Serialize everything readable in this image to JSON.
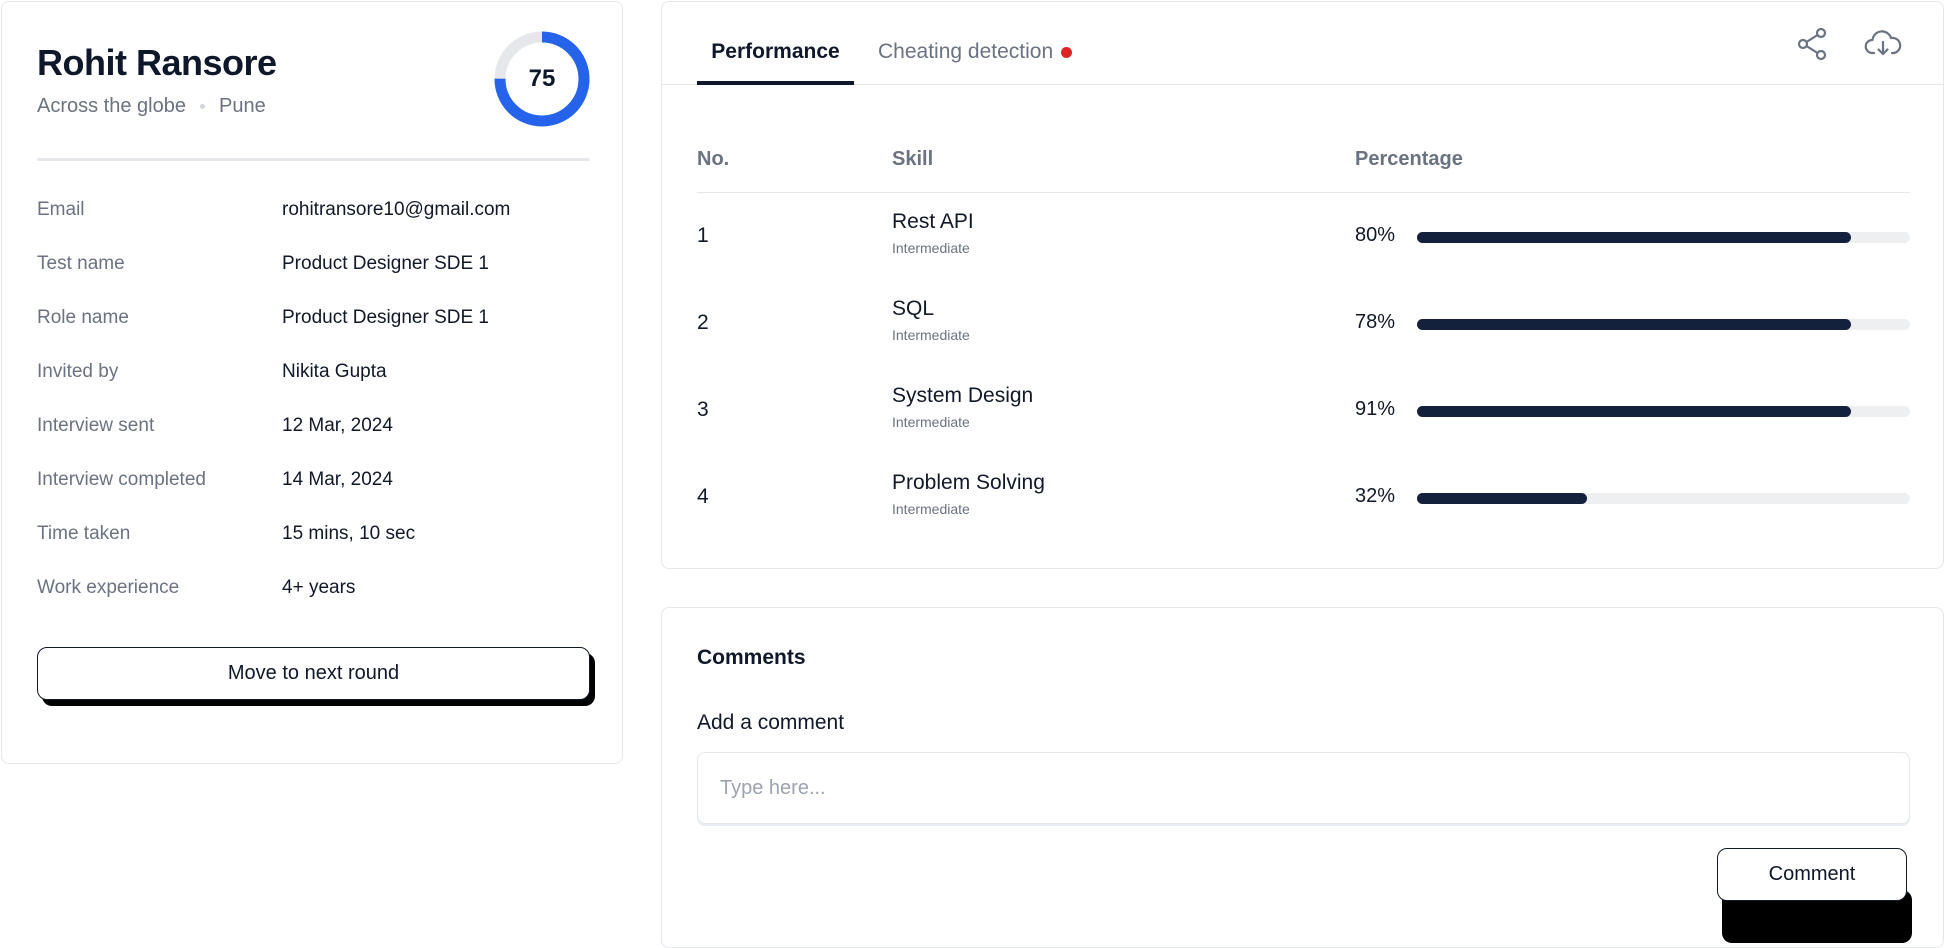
{
  "profile": {
    "name": "Rohit Ransore",
    "location_type": "Across the globe",
    "city": "Pune",
    "score": "75",
    "score_fraction": 0.75,
    "details": [
      {
        "label": "Email",
        "value": "rohitransore10@gmail.com"
      },
      {
        "label": "Test name",
        "value": "Product Designer SDE 1"
      },
      {
        "label": "Role name",
        "value": "Product Designer SDE 1"
      },
      {
        "label": "Invited by",
        "value": "Nikita Gupta"
      },
      {
        "label": "Interview sent",
        "value": "12 Mar, 2024"
      },
      {
        "label": "Interview completed",
        "value": "14 Mar, 2024"
      },
      {
        "label": "Time taken",
        "value": "15 mins, 10 sec"
      },
      {
        "label": "Work experience",
        "value": "4+ years"
      }
    ],
    "next_round_label": "Move to next round"
  },
  "tabs": {
    "performance": "Performance",
    "cheating": "Cheating detection"
  },
  "icons": {
    "share": "share-icon",
    "download": "cloud-download-icon"
  },
  "table": {
    "headers": {
      "no": "No.",
      "skill": "Skill",
      "percentage": "Percentage"
    },
    "rows": [
      {
        "no": "1",
        "skill": "Rest API",
        "level": "Intermediate",
        "pct": "80%",
        "bar_fill": 0.88
      },
      {
        "no": "2",
        "skill": "SQL",
        "level": "Intermediate",
        "pct": "78%",
        "bar_fill": 0.88
      },
      {
        "no": "3",
        "skill": "System Design",
        "level": "Intermediate",
        "pct": "91%",
        "bar_fill": 0.88
      },
      {
        "no": "4",
        "skill": "Problem Solving",
        "level": "Intermediate",
        "pct": "32%",
        "bar_fill": 0.345
      }
    ]
  },
  "comments": {
    "title": "Comments",
    "add_label": "Add a comment",
    "placeholder": "Type here...",
    "button_label": "Comment"
  },
  "colors": {
    "ring_fill": "#2563eb",
    "ring_track": "#e5e7eb",
    "bar_fill": "#14213d",
    "alert_dot": "#dc2626"
  }
}
